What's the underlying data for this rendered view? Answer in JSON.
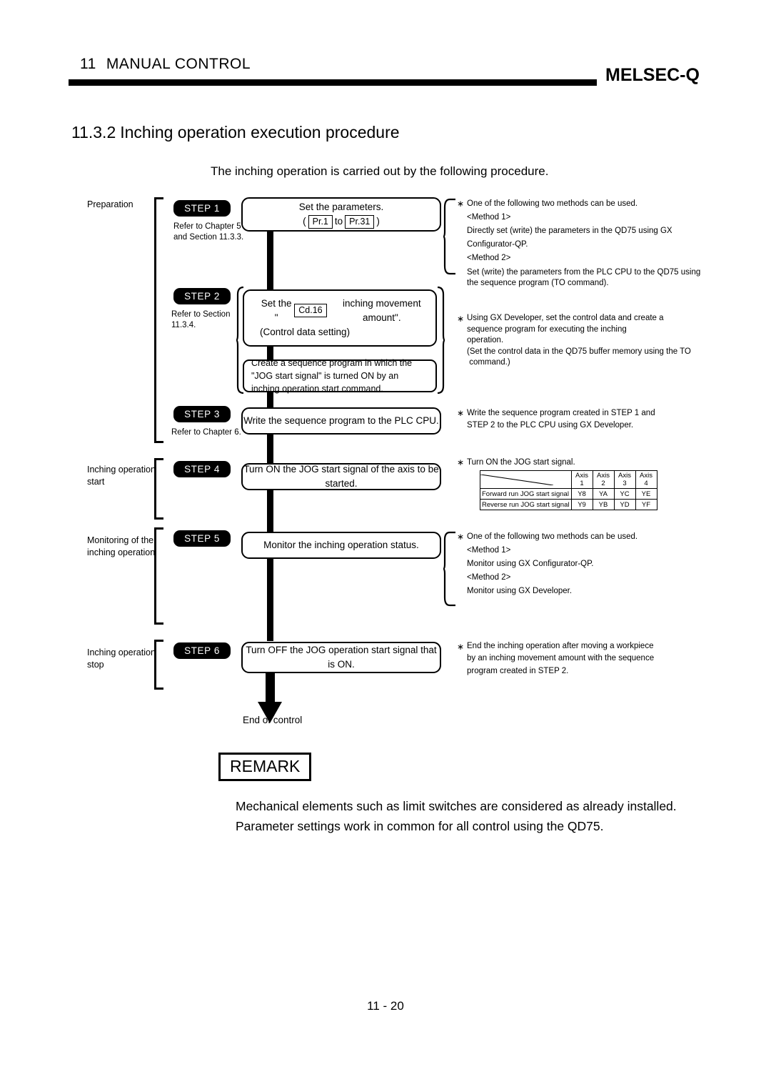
{
  "header": {
    "chapter_number": "11",
    "chapter_title": "MANUAL CONTROL",
    "brand": "MELSEC-Q"
  },
  "section": {
    "number": "11.3.2",
    "title": "Inching operation execution procedure",
    "intro": "The inching operation is carried out by the following procedure."
  },
  "phases": {
    "preparation": "Preparation",
    "inching_start": "Inching operation\nstart",
    "monitoring": "Monitoring of the\ninching operation",
    "inching_stop": "Inching operation\nstop"
  },
  "steps": [
    {
      "badge": "STEP 1",
      "refer": "Refer to Chapter 5\nand Section 11.3.3.",
      "box_line1": "Set the parameters.",
      "box_prefix": "(",
      "chip1": "Pr.1",
      "box_mid": "to",
      "chip2": "Pr.31",
      "box_suffix": ")"
    },
    {
      "badge": "STEP 2",
      "refer": "Refer to Section\n11.3.4.",
      "box_line1_a": "Set the \"",
      "chip": "Cd.16",
      "box_line1_b": "inching movement amount\".",
      "box_line2": "(Control data setting)",
      "sub_box": "Create a sequence program in which the \"JOG start signal\" is turned ON by an inching operation start command."
    },
    {
      "badge": "STEP 3",
      "refer": "Refer to Chapter 6.",
      "box": "Write the sequence program to the PLC CPU."
    },
    {
      "badge": "STEP 4",
      "box": "Turn ON the JOG start signal of the axis to be started."
    },
    {
      "badge": "STEP 5",
      "box": "Monitor the inching operation status."
    },
    {
      "badge": "STEP 6",
      "box": "Turn OFF the JOG operation start signal that is ON."
    }
  ],
  "notes": {
    "step1": {
      "star": "∗",
      "lead": "One of the following two methods can be used.",
      "method1_label": "<Method 1>",
      "method1_line1": "Directly set (write) the parameters in the QD75 using GX",
      "method1_line2": "Configurator-QP.",
      "method2_label": "<Method 2>",
      "method2_line1": "Set (write) the parameters from the PLC CPU to the QD75 using",
      "method2_line2": "the sequence program (TO command)."
    },
    "step2": {
      "star": "∗",
      "line1": "Using GX Developer, set the control data and create a",
      "line2": "sequence program for executing the inching",
      "line3": "operation.",
      "line4": "(Set the control data in the QD75 buffer memory using the TO",
      "line5": " command.)"
    },
    "step3": {
      "star": "∗",
      "line1": "Write the sequence program created in STEP 1 and",
      "line2": "STEP 2 to the PLC CPU using GX Developer."
    },
    "step4": {
      "star": "∗",
      "line1": "Turn ON the JOG start signal."
    },
    "step5": {
      "star": "∗",
      "lead": "One of the following two methods can be used.",
      "method1_label": "<Method 1>",
      "method1_line1": "Monitor using GX Configurator-QP.",
      "method2_label": "<Method 2>",
      "method2_line1": "Monitor using GX Developer."
    },
    "step6": {
      "star": "∗",
      "line1": "End the inching operation after moving a workpiece",
      "line2": "by an inching movement amount with the sequence",
      "line3": "program created in STEP 2."
    }
  },
  "axis_table": {
    "corner": "",
    "columns": [
      "Axis 1",
      "Axis 2",
      "Axis 3",
      "Axis 4"
    ],
    "rows": [
      {
        "label": "Forward run JOG start signal",
        "values": [
          "Y8",
          "YA",
          "YC",
          "YE"
        ]
      },
      {
        "label": "Reverse run JOG start signal",
        "values": [
          "Y9",
          "YB",
          "YD",
          "YF"
        ]
      }
    ]
  },
  "end_of_control": "End of control",
  "remark": {
    "title": "REMARK",
    "line1": "Mechanical elements such as limit switches are considered as already installed.",
    "line2": "Parameter settings work in common for all control using the QD75."
  },
  "footer": {
    "page": "11 - 20"
  }
}
